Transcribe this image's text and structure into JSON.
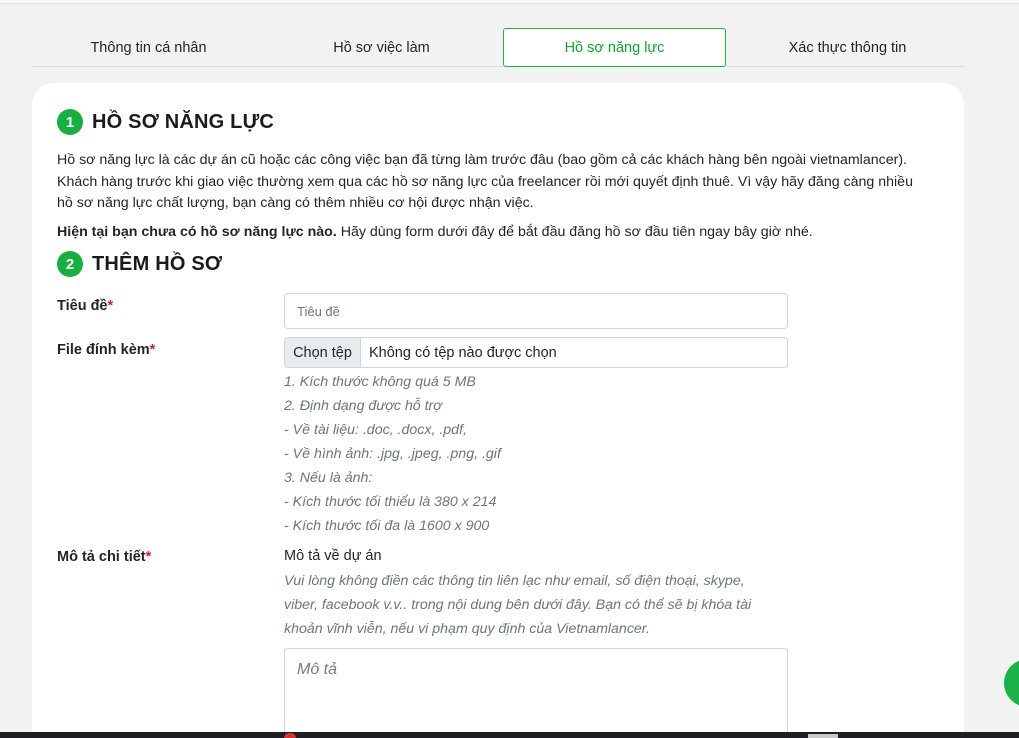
{
  "tabs": [
    {
      "label": "Thông tin cá nhân"
    },
    {
      "label": "Hồ sơ việc làm"
    },
    {
      "label": "Hồ sơ năng lực"
    },
    {
      "label": "Xác thực thông tin"
    }
  ],
  "active_tab_index": 2,
  "section1": {
    "number": "1",
    "title": "HỒ SƠ NĂNG LỰC",
    "description_lines": [
      "Hồ sơ năng lực là các dự án cũ hoặc các công việc bạn đã từng làm trước đâu (bao gồm cả các khách hàng bên ngoài vietnamlancer).",
      "Khách hàng trước khi giao việc thường xem qua các hồ sơ năng lực của freelancer rồi mới quyết định thuê. Vì vậy hãy đăng càng nhiều",
      "hồ sơ năng lực chất lượng, bạn càng có thêm nhiều cơ hội được nhận việc."
    ],
    "status_bold": "Hiện tại bạn chưa có hồ sơ năng lực nào.",
    "status_rest": " Hãy dùng form dưới đây để bắt đầu đăng hồ sơ đầu tiên ngay bây giờ nhé."
  },
  "section2": {
    "number": "2",
    "title": "THÊM HỒ SƠ"
  },
  "form": {
    "title_label": "Tiêu đề",
    "title_placeholder": "Tiêu đề",
    "title_value": "",
    "file_label": "File đính kèm",
    "file_button": "Chọn tệp",
    "file_status": "Không có tệp nào được chọn",
    "file_hints": [
      "1. Kích thước không quá 5 MB",
      "2. Định dạng được hỗ trợ",
      "- Về tài liệu: .doc, .docx, .pdf,",
      "- Về hình ảnh: .jpg, .jpeg, .png, .gif",
      "3. Nếu là ảnh:",
      "- Kích thước tối thiểu là 380 x 214",
      "- Kích thước tối đa là 1600 x 900"
    ],
    "description_label": "Mô tả chi tiết",
    "description_subtitle": "Mô tả về dự án",
    "description_note_lines": [
      "Vui lòng không điền các thông tin liên lạc như email, số điện thoại, skype,",
      "viber, facebook v.v.. trong nội dung bên dưới đây. Bạn có thể sẽ bị khóa tài",
      "khoản vĩnh viễn, nếu vi phạm quy định của Vietnamlancer."
    ],
    "description_placeholder": "Mô tả",
    "description_value": "",
    "required_mark": "*"
  },
  "colors": {
    "accent": "#17b03f",
    "required": "#dc1a3a",
    "card_bg": "#ffffff",
    "page_bg": "#f2f2f2"
  },
  "icons": [
    "chat-bubble-icon"
  ]
}
